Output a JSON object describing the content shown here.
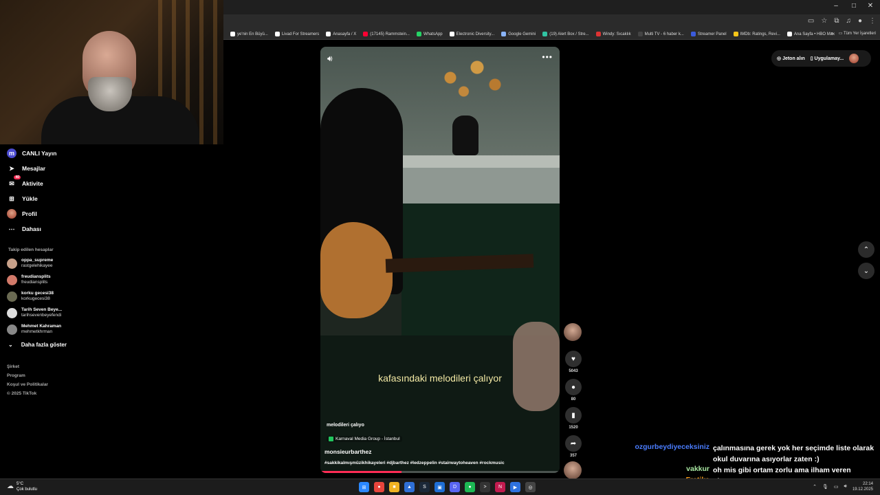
{
  "window": {
    "minimize": "–",
    "maximize": "□",
    "close": "✕"
  },
  "bookmarks": [
    {
      "label": "ye'nin En Büyü...",
      "color": "#ffffff"
    },
    {
      "label": "Livad For Streamers",
      "color": "#ffffff"
    },
    {
      "label": "Anasayfa / X",
      "color": "#ffffff"
    },
    {
      "label": "(17145) Rammstein...",
      "color": "#ff0033"
    },
    {
      "label": "WhatsApp",
      "color": "#25d366"
    },
    {
      "label": "Electronic Diversity...",
      "color": "#ffffff"
    },
    {
      "label": "Google Gemini",
      "color": "#8ab4f8"
    },
    {
      "label": "(19) Alert Box / Stre...",
      "color": "#31c3a2"
    },
    {
      "label": "Windy: Sıcaklık",
      "color": "#d33"
    },
    {
      "label": "Multi TV - 6 haber k...",
      "color": "#444"
    },
    {
      "label": "Streamer Panel",
      "color": "#3b5bdb"
    },
    {
      "label": "IMDb: Ratings, Revi...",
      "color": "#f5c518"
    },
    {
      "label": "Ana Sayfa • HBO Max",
      "color": "#ffffff"
    }
  ],
  "bookmarks_more": "»",
  "bookmarks_all": "Tüm Yer İşaretleri",
  "sidebar": {
    "nav": [
      {
        "name": "live",
        "label": "CANLI Yayın",
        "icon": "live-icon",
        "glyph": "m",
        "badge": ""
      },
      {
        "name": "messages",
        "label": "Mesajlar",
        "icon": "paper-plane-icon",
        "glyph": "➤",
        "badge": ""
      },
      {
        "name": "activity",
        "label": "Aktivite",
        "icon": "inbox-icon",
        "glyph": "✉",
        "badge": "40"
      },
      {
        "name": "upload",
        "label": "Yükle",
        "icon": "plus-square-icon",
        "glyph": "⊞",
        "badge": ""
      },
      {
        "name": "profile",
        "label": "Profil",
        "icon": "avatar-icon",
        "glyph": "",
        "badge": ""
      },
      {
        "name": "more",
        "label": "Dahası",
        "icon": "ellipsis-icon",
        "glyph": "⋯",
        "badge": ""
      }
    ],
    "following_title": "Takip edilen hesaplar",
    "following": [
      {
        "name": "oppa_supreme",
        "user": "rastgelehikayee",
        "color": "#c8a18a"
      },
      {
        "name": "freudiansplits",
        "user": "freudiansplits",
        "color": "#d27a6a"
      },
      {
        "name": "korku gecesi38",
        "user": "korkugecesi38",
        "color": "#6a6a52"
      },
      {
        "name": "Tarih Seven Beye...",
        "user": "tarihsevenbeyefendi",
        "color": "#dddddd"
      },
      {
        "name": "Mehmet Kahraman",
        "user": "mehmetkhrman",
        "color": "#888888"
      }
    ],
    "show_more": "Daha fazla göster",
    "footer": [
      "Şirket",
      "Program",
      "Koşul ve Politikalar",
      "© 2025 TikTok"
    ]
  },
  "video": {
    "caption_overlay": "kafasındaki melodileri çalıyor",
    "title": "melodileri çalıyo",
    "music": "Karnaval Media Group - İstanbul",
    "author": "monsieurbarthez",
    "tags": "#sakkikalmışmüzikhikayeleri #djbarthez #ledzeppelin #stairwaytoheaven #rockmusic",
    "progress": 0.34
  },
  "actions": {
    "likes": "5043",
    "comments": "80",
    "saves": "1520",
    "shares": "357"
  },
  "topright": {
    "coins": "Jeton alın",
    "app": "Uygulamay..."
  },
  "chat": [
    {
      "user": "ozgurbeydiyeceksiniz",
      "color": "#4a7dff",
      "msg": "çalınmasına gerek yok her seçimde liste olarak okul duvarına asıyorlar zaten :)"
    },
    {
      "user": "vakkur",
      "color": "#a8e6a1",
      "msg": "oh mis gibi ortam zorlu ama ilham veren"
    },
    {
      "user": "Fratika",
      "color": "#ff9f1a",
      "msg": "ok"
    }
  ],
  "taskbar": {
    "temp": "5°C",
    "weather": "Çok bulutlu",
    "time": "22:14",
    "date": "19.12.2025",
    "apps": [
      {
        "name": "windows-start",
        "color": "#2b88ff",
        "glyph": "⊞"
      },
      {
        "name": "chrome",
        "color": "#e8453c",
        "glyph": "●"
      },
      {
        "name": "file-explorer",
        "color": "#f0b323",
        "glyph": "■"
      },
      {
        "name": "app-blue",
        "color": "#2f6fd6",
        "glyph": "▲"
      },
      {
        "name": "steam",
        "color": "#1b2838",
        "glyph": "S"
      },
      {
        "name": "app-blue2",
        "color": "#1f6ed4",
        "glyph": "▣"
      },
      {
        "name": "discord",
        "color": "#5865f2",
        "glyph": "D"
      },
      {
        "name": "spotify",
        "color": "#1db954",
        "glyph": "●"
      },
      {
        "name": "terminal",
        "color": "#333333",
        "glyph": ">"
      },
      {
        "name": "app-red",
        "color": "#c21b4f",
        "glyph": "N"
      },
      {
        "name": "app-blue3",
        "color": "#2e72e0",
        "glyph": "▶"
      },
      {
        "name": "app-ring",
        "color": "#444444",
        "glyph": "◎"
      }
    ]
  }
}
